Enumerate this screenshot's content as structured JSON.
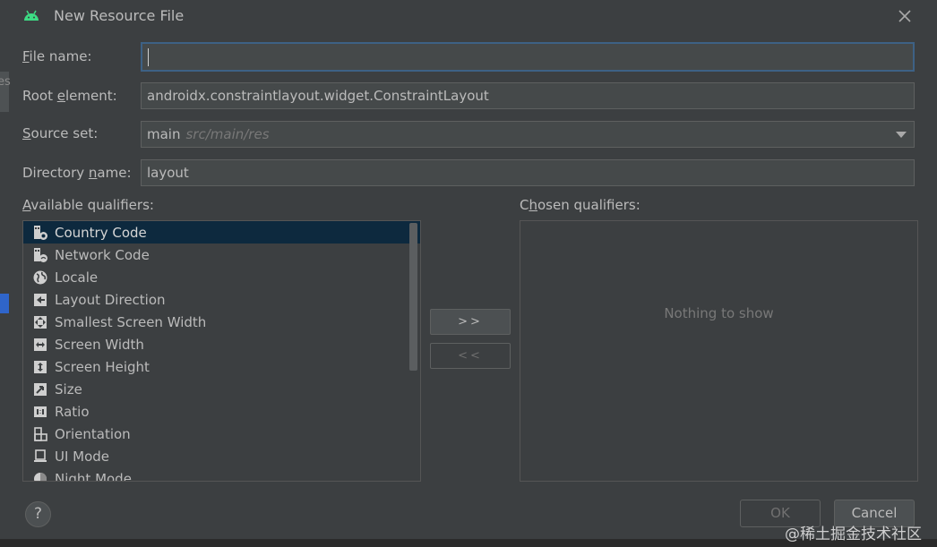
{
  "window": {
    "title": "New Resource File",
    "app_icon": "android-icon",
    "close_icon": "close-icon"
  },
  "background_fragment": "es",
  "form": {
    "file_name": {
      "label_prefix": "F",
      "label_rest": "ile name:",
      "value": ""
    },
    "root_element": {
      "label_prefix": "Root ",
      "label_underlined": "e",
      "label_rest": "lement:",
      "value": "androidx.constraintlayout.widget.ConstraintLayout"
    },
    "source_set": {
      "label_underlined": "S",
      "label_rest": "ource set:",
      "value": "main",
      "hint": "src/main/res"
    },
    "directory_name": {
      "label_prefix": "Directory ",
      "label_underlined": "n",
      "label_rest": "ame:",
      "value": "layout"
    }
  },
  "available": {
    "label_prefix": "A",
    "label_rest": "vailable qualifiers:",
    "items": [
      {
        "label": "Country Code",
        "icon": "country-code-icon",
        "selected": true
      },
      {
        "label": "Network Code",
        "icon": "network-code-icon",
        "selected": false
      },
      {
        "label": "Locale",
        "icon": "globe-icon",
        "selected": false
      },
      {
        "label": "Layout Direction",
        "icon": "layout-direction-icon",
        "selected": false
      },
      {
        "label": "Smallest Screen Width",
        "icon": "smallest-width-icon",
        "selected": false
      },
      {
        "label": "Screen Width",
        "icon": "screen-width-icon",
        "selected": false
      },
      {
        "label": "Screen Height",
        "icon": "screen-height-icon",
        "selected": false
      },
      {
        "label": "Size",
        "icon": "size-icon",
        "selected": false
      },
      {
        "label": "Ratio",
        "icon": "ratio-icon",
        "selected": false
      },
      {
        "label": "Orientation",
        "icon": "orientation-icon",
        "selected": false
      },
      {
        "label": "UI Mode",
        "icon": "ui-mode-icon",
        "selected": false
      },
      {
        "label": "Night Mode",
        "icon": "night-mode-icon",
        "selected": false
      }
    ]
  },
  "chosen": {
    "label_prefix": "C",
    "label_underlined": "h",
    "label_rest": "osen qualifiers:",
    "empty_text": "Nothing to show"
  },
  "buttons": {
    "add": ">>",
    "remove": "<<",
    "help": "?",
    "ok": "OK",
    "cancel": "Cancel"
  },
  "watermark": "@稀土掘金技术社区",
  "colors": {
    "dialog_bg": "#3c3f41",
    "field_bg": "#45494a",
    "selection_bg": "#0d293e",
    "focus_border": "#3d6185",
    "android_green": "#3ddc84"
  }
}
